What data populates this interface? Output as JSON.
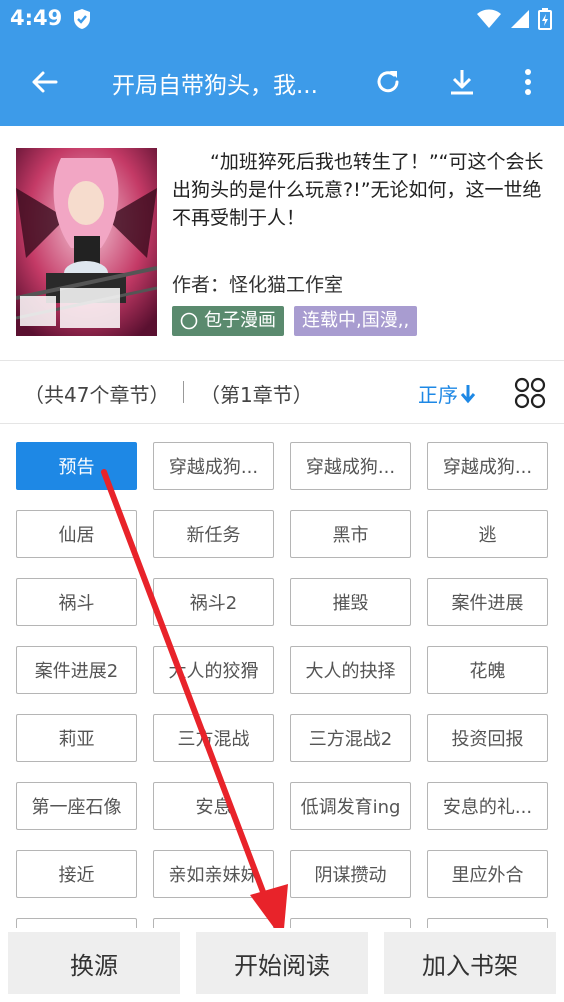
{
  "status_bar": {
    "time": "4:49"
  },
  "app_bar": {
    "title": "开局自带狗头，我...",
    "back_icon": "arrow-left-icon",
    "refresh_icon": "refresh-icon",
    "download_icon": "download-icon",
    "more_icon": "more-vertical-icon"
  },
  "book": {
    "description": "“加班猝死后我也转生了！”“可这个会长出狗头的是什么玩意?!”无论如何，这一世绝不再受制于人！",
    "author": "作者：怪化猫工作室",
    "source_tag": "包子漫画",
    "status_tag": "连载中,国漫,,",
    "colors": {
      "source_tag": "#5a8a6e",
      "status_tag": "#a89cd0"
    }
  },
  "chapter_bar": {
    "total": "（共47个章节）",
    "current": "（第1章节）",
    "sort_label": "正序",
    "sort_icon": "arrow-down-icon",
    "grid_icon": "grid-view-icon"
  },
  "chapters": [
    "预告",
    "穿越成狗...",
    "穿越成狗...",
    "穿越成狗...",
    "仙居",
    "新任务",
    "黑市",
    "逃",
    "祸斗",
    "祸斗2",
    "摧毁",
    "案件进展",
    "案件进展2",
    "大人的狡猾",
    "大人的抉择",
    "花魄",
    "莉亚",
    "三方混战",
    "三方混战2",
    "投资回报",
    "第一座石像",
    "安息",
    "低调发育ing",
    "安息的礼...",
    "接近",
    "亲如亲妹妹",
    "阴谋攒动",
    "里应外合",
    "",
    "",
    "",
    ""
  ],
  "bottom_bar": {
    "change_source": "换源",
    "start_reading": "开始阅读",
    "add_shelf": "加入书架"
  },
  "accent_color": "#3d9be9",
  "highlight_color": "#1e88e5",
  "annotation_color": "#e8232a"
}
